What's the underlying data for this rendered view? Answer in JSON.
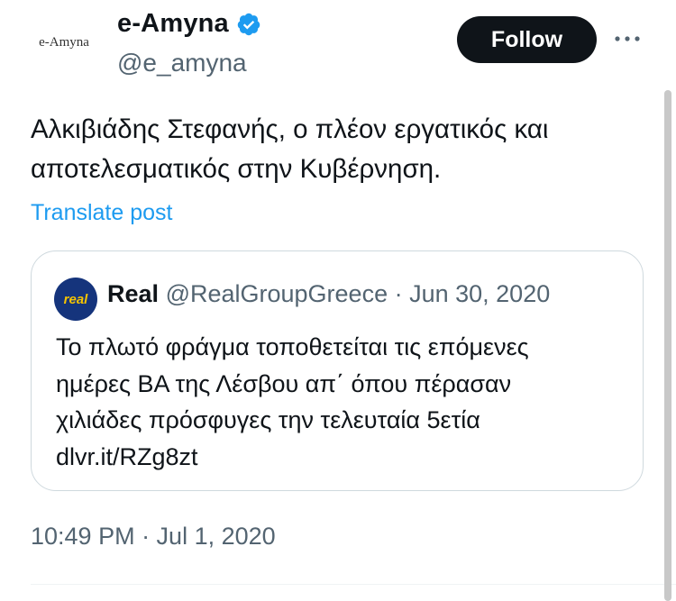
{
  "author": {
    "avatar_text": "e-Amyna",
    "display_name": "e-Amyna",
    "handle": "@e_amyna",
    "verified_icon": "verified-badge-icon",
    "follow_label": "Follow",
    "more_icon": "more-icon"
  },
  "tweet": {
    "text_line1": "Αλκιβιάδης Στεφανής, ο πλέον εργατικός και",
    "text_line2": "αποτελεσματικός στην Κυβέρνηση.",
    "translate_label": "Translate post",
    "timestamp": "10:49 PM · Jul 1, 2020"
  },
  "quote": {
    "avatar_text": "real",
    "name": "Real",
    "handle": "@RealGroupGreece",
    "separator": " · ",
    "date": "Jun 30, 2020",
    "line1": "Το πλωτό φράγμα τοποθετείται τις επόμενες",
    "line2": "ημέρες ΒΑ της Λέσβου απ΄ όπου πέρασαν",
    "line3": "χιλιάδες πρόσφυγες την τελευταία 5ετία",
    "line4": "dlvr.it/RZg8zt"
  },
  "colors": {
    "link": "#1d9bf0",
    "secondary_text": "#536471",
    "verified": "#1d9bf0",
    "follow_bg": "#0f1419",
    "quote_avatar_bg": "#15347c",
    "quote_avatar_text": "#f6c400"
  }
}
